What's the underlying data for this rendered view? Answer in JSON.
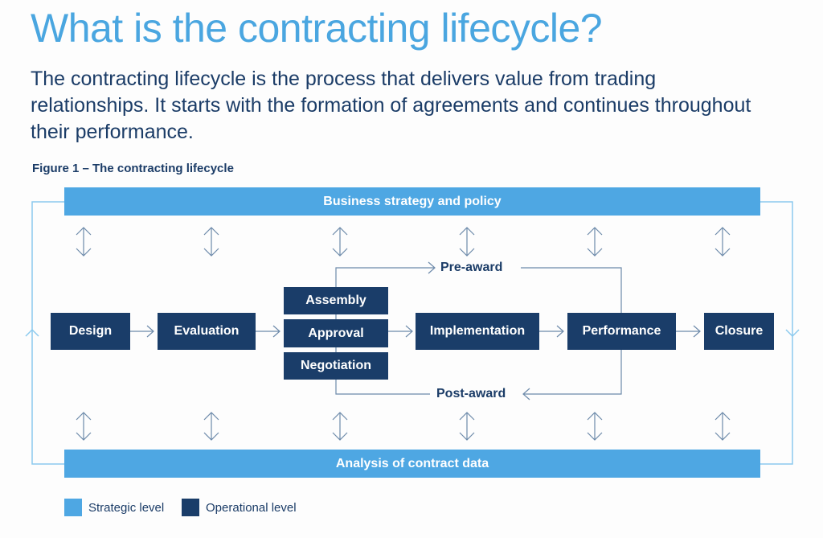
{
  "header": {
    "title": "What is the contracting lifecycle?",
    "intro": "The contracting lifecycle is the process that delivers value from trading relationships. It starts with the formation of agreements and continues throughout their performance."
  },
  "figure": {
    "caption": "Figure 1 – The contracting lifecycle",
    "strategic_top": "Business strategy and policy",
    "strategic_bottom": "Analysis of contract data",
    "stages": {
      "design": "Design",
      "evaluation": "Evaluation",
      "assembly": "Assembly",
      "approval": "Approval",
      "negotiation": "Negotiation",
      "implementation": "Implementation",
      "performance": "Performance",
      "closure": "Closure"
    },
    "flow_labels": {
      "pre_award": "Pre-award",
      "post_award": "Post-award"
    },
    "legend": [
      {
        "label": "Strategic level",
        "color": "#4ea7e3"
      },
      {
        "label": "Operational level",
        "color": "#1a3d69"
      }
    ]
  },
  "colors": {
    "strategic": "#4ea7e3",
    "operational": "#1a3d69",
    "title": "#4aa6e0",
    "text": "#1b3c67",
    "connector": "#6d8aaa",
    "loop": "#8ccaee"
  }
}
